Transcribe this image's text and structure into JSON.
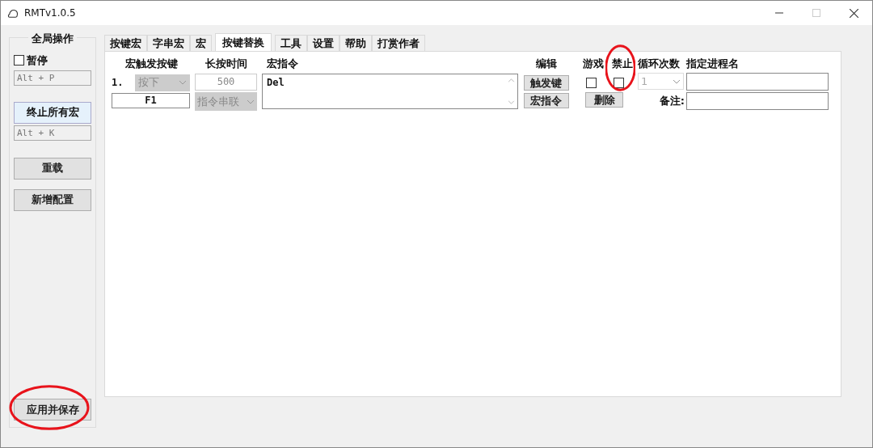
{
  "window": {
    "title": "RMTv1.0.5"
  },
  "sidebar": {
    "title": "全局操作",
    "pause": {
      "label": "暂停",
      "checked": false
    },
    "pause_hotkey": "Alt + P",
    "stop_button": "终止所有宏",
    "stop_hotkey": "Alt + K",
    "reload_button": "重载",
    "add_config_button": "新增配置",
    "apply_button": {
      "label": "应用并保存",
      "highlight": true
    }
  },
  "tabs": [
    {
      "label": "按键宏",
      "selected": false
    },
    {
      "label": "字串宏",
      "selected": false
    },
    {
      "label": "宏",
      "selected": false
    },
    {
      "label": "按键替换",
      "selected": true
    },
    {
      "label": "工具",
      "selected": false
    },
    {
      "label": "设置",
      "selected": false
    },
    {
      "label": "帮助",
      "selected": false
    },
    {
      "label": "打赏作者",
      "selected": false
    }
  ],
  "headers": {
    "trigger": "宏触发按键",
    "duration": "长按时间",
    "command": "宏指令",
    "edit": "编辑",
    "game": "游戏",
    "forbid": {
      "label": "禁止",
      "highlight": true
    },
    "loop": "循环次数",
    "process": "指定进程名"
  },
  "rows": [
    {
      "index": "1.",
      "trigger_mode": "按下",
      "key": "F1",
      "duration": "500",
      "chain_mode": "指令串联",
      "command": "Del",
      "edit_buttons": [
        "触发键",
        "宏指令"
      ],
      "game": false,
      "forbid": false,
      "delete_button": "删除",
      "loop": "1",
      "note_label": "备注:"
    }
  ]
}
